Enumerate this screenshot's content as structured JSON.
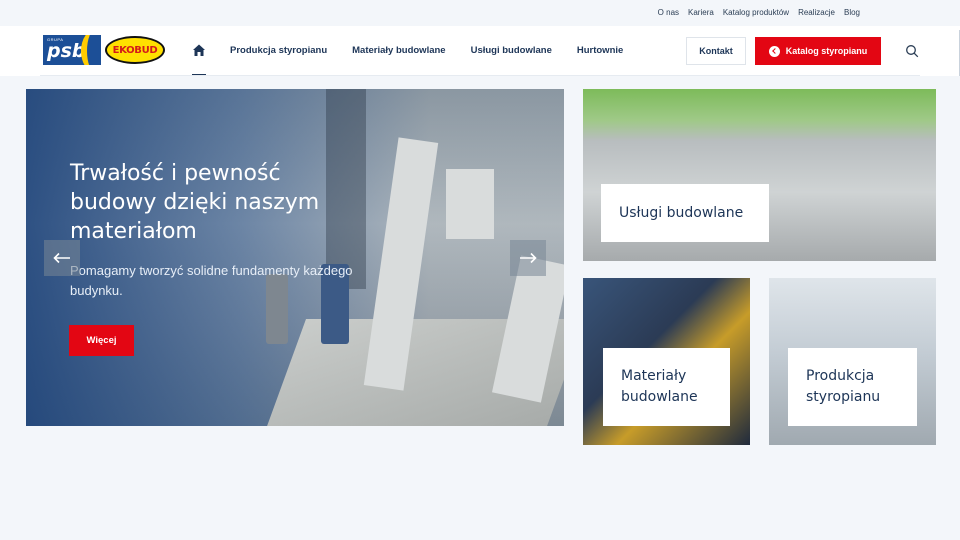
{
  "topbar": {
    "links": [
      "O nas",
      "Kariera",
      "Katalog produktów",
      "Realizacje",
      "Blog"
    ]
  },
  "logo": {
    "psb_small": "GRUPA",
    "psb": "psb",
    "ekobud": "EKOBUD"
  },
  "nav": {
    "items": [
      "Produkcja styropianu",
      "Materiały budowlane",
      "Usługi budowlane",
      "Hurtownie"
    ]
  },
  "actions": {
    "contact": "Kontakt",
    "catalog": "Katalog styropianu"
  },
  "hero": {
    "title": "Trwałość i pewność budowy dzięki naszym materiałom",
    "subtitle": "Pomagamy tworzyć solidne fundamenty każdego budynku.",
    "button": "Więcej"
  },
  "tiles": {
    "uslugi": "Usługi budowlane",
    "materialy": "Materiały budowlane",
    "produkcja": "Produkcja styropianu"
  },
  "colors": {
    "brand_red": "#e30613",
    "navy": "#1d3557",
    "background": "#f3f6fa"
  },
  "icons": {
    "home": "home-icon",
    "search": "search-icon",
    "prev": "arrow-left-icon",
    "next": "arrow-right-icon",
    "catalog": "chevron-left-circle-icon"
  }
}
